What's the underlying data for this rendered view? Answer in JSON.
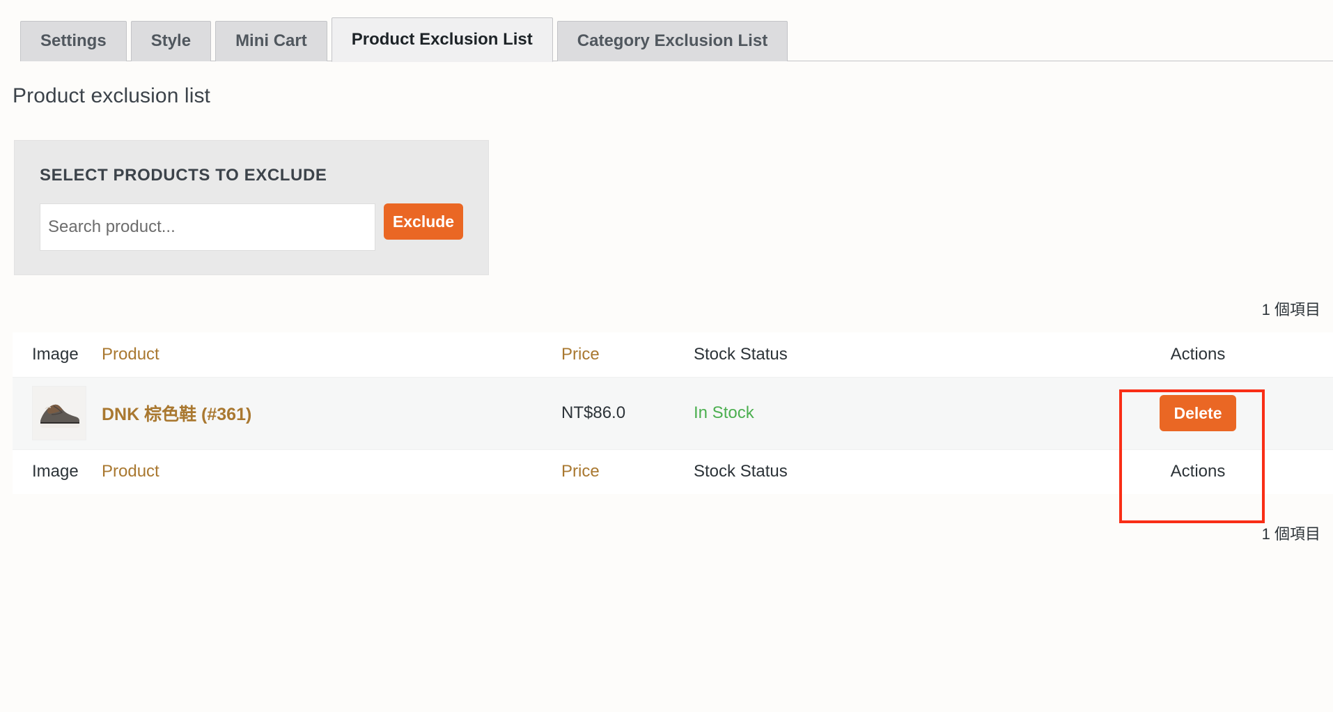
{
  "tabs": [
    {
      "label": "Settings",
      "active": false
    },
    {
      "label": "Style",
      "active": false
    },
    {
      "label": "Mini Cart",
      "active": false
    },
    {
      "label": "Product Exclusion List",
      "active": true
    },
    {
      "label": "Category Exclusion List",
      "active": false
    }
  ],
  "page": {
    "heading": "Product exclusion list"
  },
  "select_panel": {
    "title": "SELECT PRODUCTS TO EXCLUDE",
    "search_placeholder": "Search product...",
    "search_value": "",
    "exclude_button": "Exclude"
  },
  "counts": {
    "top": "1 個項目",
    "bottom": "1 個項目"
  },
  "table": {
    "columns": [
      {
        "key": "image",
        "label": "Image",
        "sortable": false
      },
      {
        "key": "product",
        "label": "Product",
        "sortable": true
      },
      {
        "key": "price",
        "label": "Price",
        "sortable": true
      },
      {
        "key": "stock",
        "label": "Stock Status",
        "sortable": false
      },
      {
        "key": "actions",
        "label": "Actions",
        "sortable": false
      }
    ],
    "rows": [
      {
        "image_alt": "product-thumbnail-shoe",
        "product": "DNK 棕色鞋 (#361)",
        "price": "NT$86.0",
        "stock": "In Stock",
        "action_button": "Delete"
      }
    ]
  },
  "colors": {
    "accent_orange": "#ea6724",
    "link_brown": "#a97830",
    "in_stock_green": "#4caf50",
    "annotation_red": "#f92e16",
    "panel_gray": "#e9e9e9",
    "page_background": "#fdfcfa"
  }
}
